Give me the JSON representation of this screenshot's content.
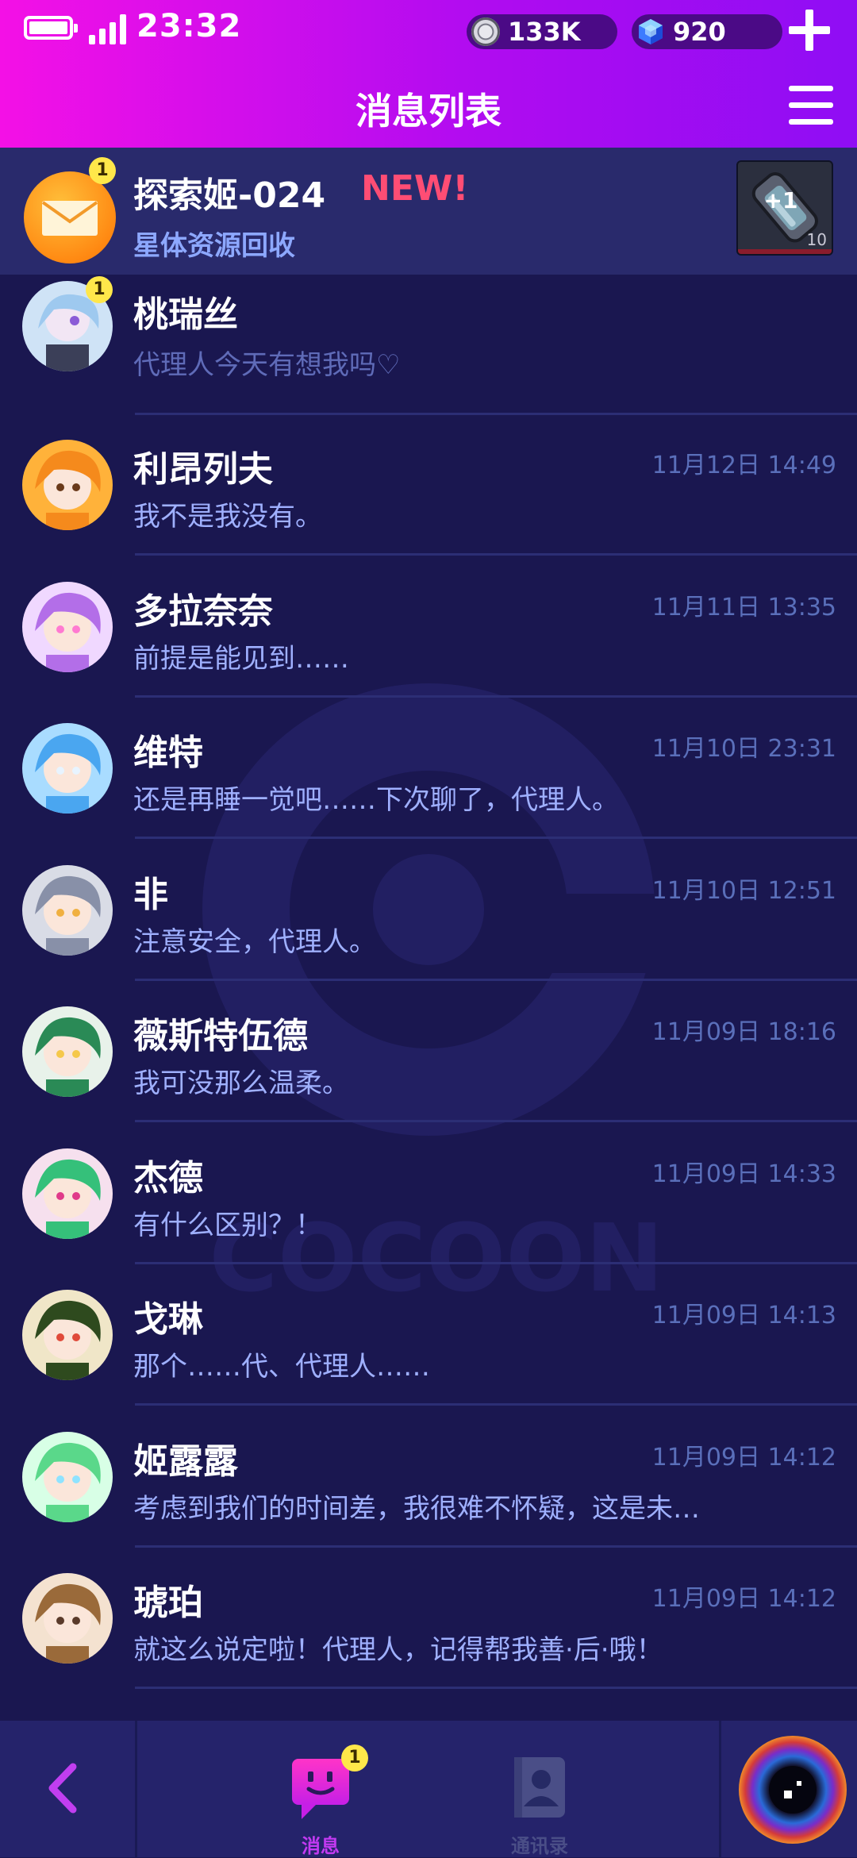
{
  "status_bar": {
    "time": "23:32",
    "battery_level": 1.0
  },
  "currency": {
    "coins": "133K",
    "gems": "920"
  },
  "header": {
    "title": "消息列表"
  },
  "special_message": {
    "sender": "探索姬-024",
    "new_tag": "NEW!",
    "subtitle": "星体资源回收",
    "unread_count": "1",
    "attachment_label": "+1",
    "attachment_qty": "10"
  },
  "pinned_row": {
    "name": "桃瑞丝",
    "preview": "代理人今天有想我吗♡",
    "unread_count": "1"
  },
  "conversations": [
    {
      "name": "利昂列夫",
      "preview": "我不是我没有。",
      "time": "11月12日 14:49"
    },
    {
      "name": "多拉奈奈",
      "preview": "前提是能见到……",
      "time": "11月11日 13:35"
    },
    {
      "name": "维特",
      "preview": "还是再睡一觉吧……下次聊了，代理人。",
      "time": "11月10日 23:31"
    },
    {
      "name": "非",
      "preview": "注意安全，代理人。",
      "time": "11月10日 12:51"
    },
    {
      "name": "薇斯特伍德",
      "preview": "我可没那么温柔。",
      "time": "11月09日 18:16"
    },
    {
      "name": "杰德",
      "preview": "有什么区别？！",
      "time": "11月09日 14:33"
    },
    {
      "name": "戈琳",
      "preview": "那个……代、代理人……",
      "time": "11月09日 14:13"
    },
    {
      "name": "姬露露",
      "preview": "考虑到我们的时间差，我很难不怀疑，这是未…",
      "time": "11月09日 14:12"
    },
    {
      "name": "琥珀",
      "preview": "就这么说定啦！代理人，记得帮我善·后·哦！",
      "time": "11月09日 14:12"
    }
  ],
  "watermark_text": "COCOON",
  "bottom_nav": {
    "messages_label": "消息",
    "messages_badge": "1",
    "contacts_label": "通讯录"
  },
  "colors": {
    "header_start": "#f410e6",
    "header_end": "#8f0df4",
    "background": "#1a1750",
    "preview_text": "#9fb0ff",
    "new_tag": "#ff4d74",
    "badge": "#ffe74a"
  },
  "icons": [
    "battery-icon",
    "signal-icon",
    "coin-icon",
    "gem-icon",
    "plus-icon",
    "menu-icon",
    "envelope-icon",
    "back-arrow-icon",
    "messages-icon",
    "contacts-icon",
    "portal-icon"
  ]
}
